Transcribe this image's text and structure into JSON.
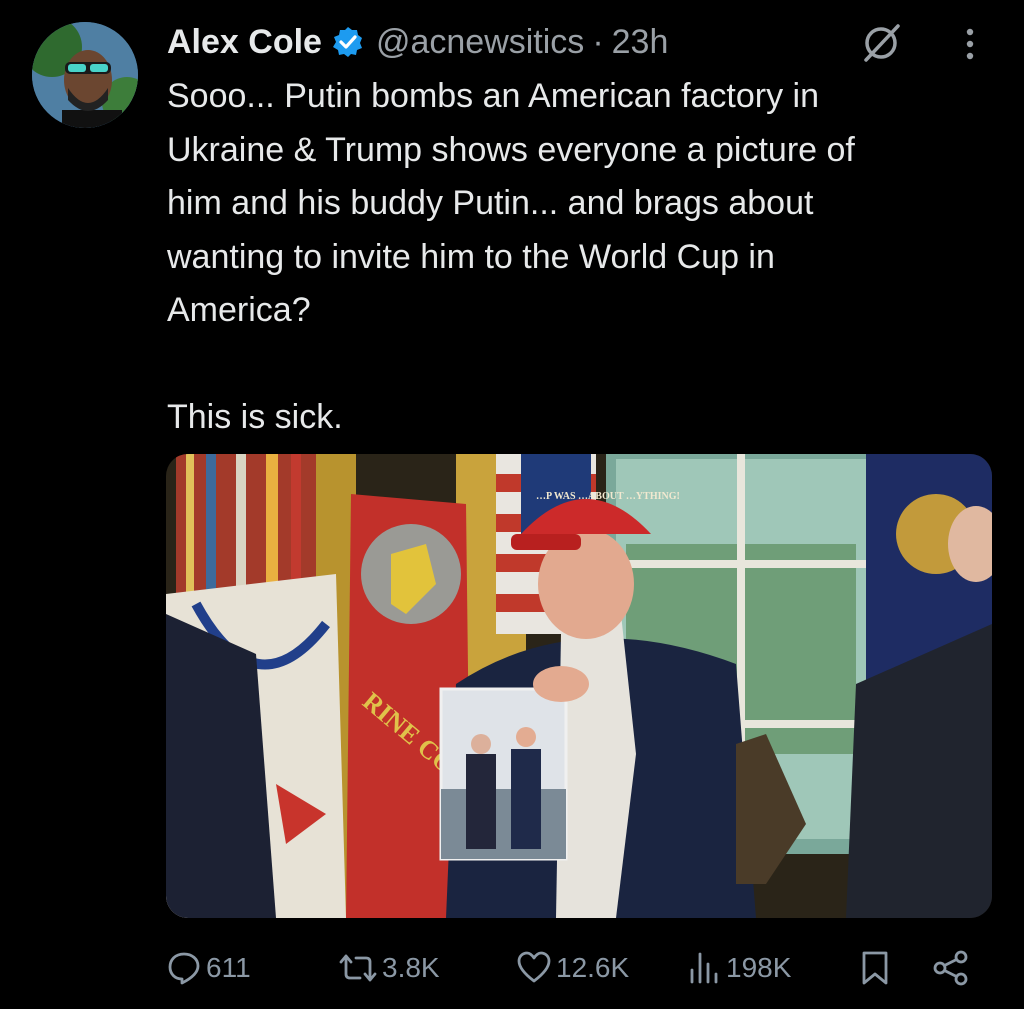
{
  "tweet": {
    "author_name": "Alex Cole",
    "handle": "@acnewsitics",
    "separator": "·",
    "time": "23h",
    "text": "Sooo... Putin bombs an American factory in\nUkraine & Trump shows everyone a picture of\nhim and his buddy Putin... and brags about\nwanting to invite him to the World Cup in\nAmerica?\n\nThis is sick.",
    "media_banner_text": "RINE COR",
    "hat_text": "…P WAS …ABOUT …YTHING!"
  },
  "actions": {
    "replies": "611",
    "reposts": "3.8K",
    "likes": "12.6K",
    "views": "198K"
  },
  "colors": {
    "background": "#000000",
    "text": "#e7e9ea",
    "secondary": "#9aa0a6",
    "verified": "#1d9bf0"
  },
  "icons": [
    "verified-badge-icon",
    "grok-icon",
    "more-icon",
    "reply-icon",
    "repost-icon",
    "like-icon",
    "views-icon",
    "bookmark-icon",
    "share-icon"
  ]
}
